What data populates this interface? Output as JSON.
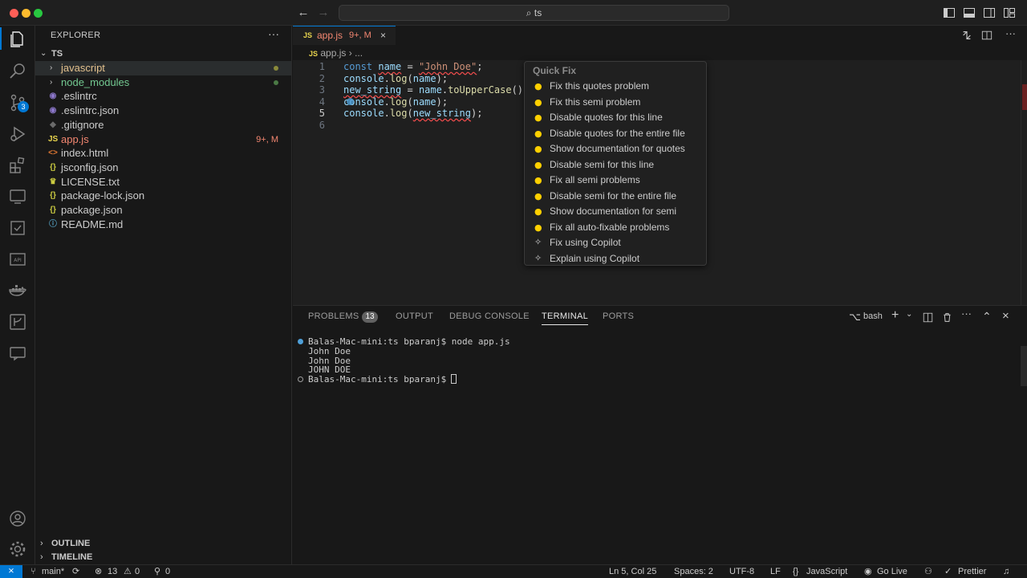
{
  "window": {
    "search_text": "ts"
  },
  "activity": {
    "scm_badge": "3"
  },
  "sidebar": {
    "title": "EXPLORER",
    "root": "TS",
    "items": [
      {
        "label": "javascript",
        "kind": "folder",
        "color": "#e2c08d",
        "decoration": "dot",
        "dot_color": "#8a8a3a"
      },
      {
        "label": "node_modules",
        "kind": "folder",
        "color": "#73c991",
        "decoration": "dot",
        "dot_color": "#4b7a45"
      },
      {
        "label": ".eslintrc",
        "kind": "eslint",
        "color": "#cccccc"
      },
      {
        "label": ".eslintrc.json",
        "kind": "eslint",
        "color": "#cccccc"
      },
      {
        "label": ".gitignore",
        "kind": "git",
        "color": "#cccccc"
      },
      {
        "label": "app.js",
        "kind": "js",
        "color": "#f48771",
        "decoration": "9+, M"
      },
      {
        "label": "index.html",
        "kind": "html",
        "color": "#cccccc"
      },
      {
        "label": "jsconfig.json",
        "kind": "json",
        "color": "#cccccc"
      },
      {
        "label": "LICENSE.txt",
        "kind": "license",
        "color": "#cccccc"
      },
      {
        "label": "package-lock.json",
        "kind": "json",
        "color": "#cccccc"
      },
      {
        "label": "package.json",
        "kind": "json",
        "color": "#cccccc"
      },
      {
        "label": "README.md",
        "kind": "md",
        "color": "#cccccc"
      }
    ],
    "outline": "OUTLINE",
    "timeline": "TIMELINE"
  },
  "editor": {
    "tab": {
      "icon": "JS",
      "name": "app.js",
      "status": "9+, M"
    },
    "breadcrumb": {
      "file": "app.js",
      "rest": "..."
    },
    "line_numbers": [
      "1",
      "2",
      "3",
      "4",
      "5",
      "6"
    ],
    "current_line": "5"
  },
  "quick_fix": {
    "title": "Quick Fix",
    "items": [
      {
        "label": "Fix this quotes problem",
        "icon": "lightbulb-icon"
      },
      {
        "label": "Fix this semi problem",
        "icon": "lightbulb-icon"
      },
      {
        "label": "Disable quotes for this line",
        "icon": "lightbulb-icon"
      },
      {
        "label": "Disable quotes for the entire file",
        "icon": "lightbulb-icon"
      },
      {
        "label": "Show documentation for quotes",
        "icon": "lightbulb-icon"
      },
      {
        "label": "Disable semi for this line",
        "icon": "lightbulb-icon"
      },
      {
        "label": "Fix all semi problems",
        "icon": "lightbulb-icon"
      },
      {
        "label": "Disable semi for the entire file",
        "icon": "lightbulb-icon"
      },
      {
        "label": "Show documentation for semi",
        "icon": "lightbulb-icon"
      },
      {
        "label": "Fix all auto-fixable problems",
        "icon": "lightbulb-icon"
      },
      {
        "label": "Fix using Copilot",
        "icon": "sparkle-icon"
      },
      {
        "label": "Explain using Copilot",
        "icon": "sparkle-icon"
      }
    ]
  },
  "panel": {
    "tabs": [
      "PROBLEMS",
      "OUTPUT",
      "DEBUG CONSOLE",
      "TERMINAL",
      "PORTS"
    ],
    "problems_count": "13",
    "active_tab": "TERMINAL",
    "shell": "bash",
    "terminal_lines": [
      "Balas-Mac-mini:ts bparanj$ node app.js",
      "John Doe",
      "John Doe",
      "JOHN DOE",
      "Balas-Mac-mini:ts bparanj$ "
    ]
  },
  "status": {
    "branch": "main*",
    "errors": "13",
    "warnings": "0",
    "ports": "0",
    "position": "Ln 5, Col 25",
    "spaces": "Spaces: 2",
    "encoding": "UTF-8",
    "eol": "LF",
    "language": "JavaScript",
    "go_live": "Go Live",
    "prettier": "Prettier"
  },
  "colors": {
    "accent": "#0078d4",
    "error": "#f14c4c",
    "warning_bulb": "#ffcc00"
  }
}
